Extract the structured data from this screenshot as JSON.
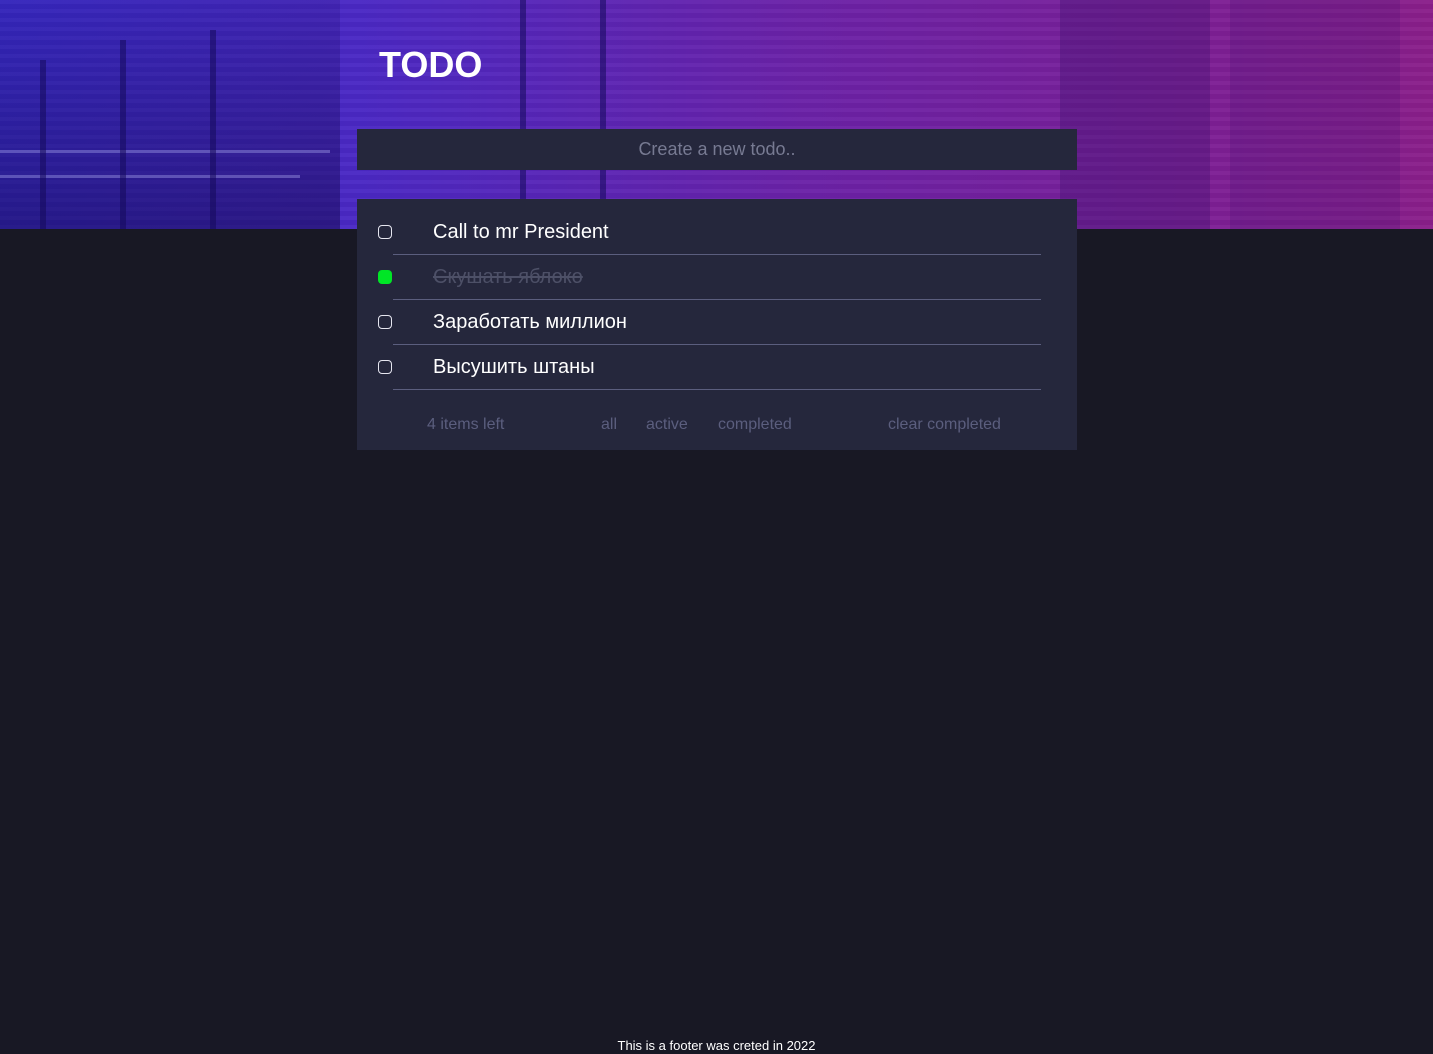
{
  "header": {
    "title": "TODO"
  },
  "new_todo": {
    "placeholder": "Create a new todo.."
  },
  "todos": [
    {
      "text": "Call to mr President",
      "completed": false
    },
    {
      "text": "Скушать яблоко",
      "completed": true
    },
    {
      "text": "Заработать миллион",
      "completed": false
    },
    {
      "text": "Высушить штаны",
      "completed": false
    }
  ],
  "controls": {
    "items_left": "4 items left",
    "filter_all": "all",
    "filter_active": "active",
    "filter_completed": "completed",
    "clear_completed": "clear completed"
  },
  "footer": {
    "text": "This is a footer was creted in 2022"
  },
  "colors": {
    "page_bg": "#181824",
    "card_bg": "#25273c",
    "check_done": "#00e626",
    "muted_text": "#5b5e7e"
  }
}
